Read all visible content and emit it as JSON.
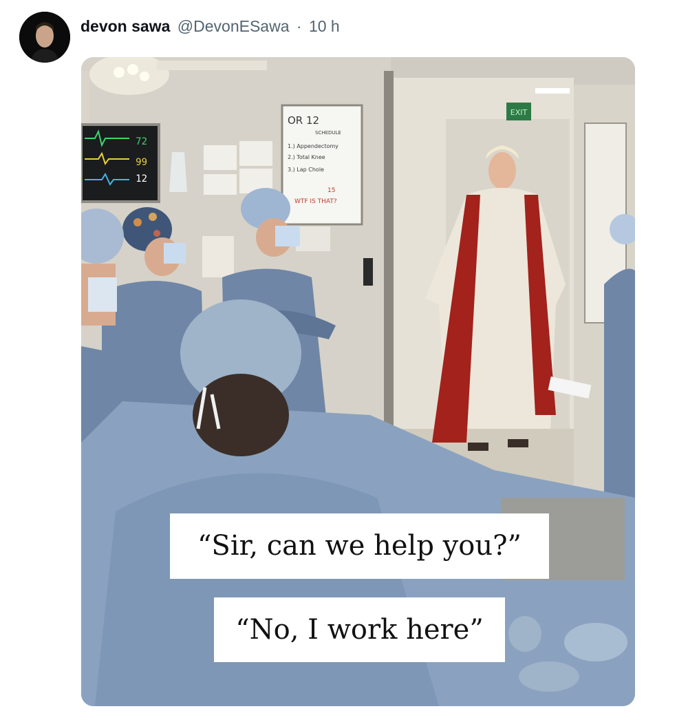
{
  "tweet": {
    "display_name": "devon sawa",
    "handle": "@DevonESawa",
    "separator": "·",
    "time": "10 h"
  },
  "media": {
    "board": {
      "title": "OR 12",
      "subtitle": "SCHEDULE",
      "items": [
        "1.) Appendectomy",
        "2.) Total Knee",
        "3.) Lap Chole"
      ],
      "line4": "15",
      "line5": "WTF IS THAT?"
    },
    "monitor": {
      "values": [
        "72",
        "99",
        "12"
      ]
    },
    "exit_sign": "EXIT",
    "captions": [
      "“Sir, can we help you?”",
      "“No, I work here”"
    ]
  },
  "colors": {
    "name": "#0f1419",
    "secondary_text": "#536471",
    "scrubs": "#6f86a6",
    "robe_red": "#a3221c",
    "robe_white": "#ece7da"
  },
  "icons": {
    "avatar": "profile-photo"
  }
}
